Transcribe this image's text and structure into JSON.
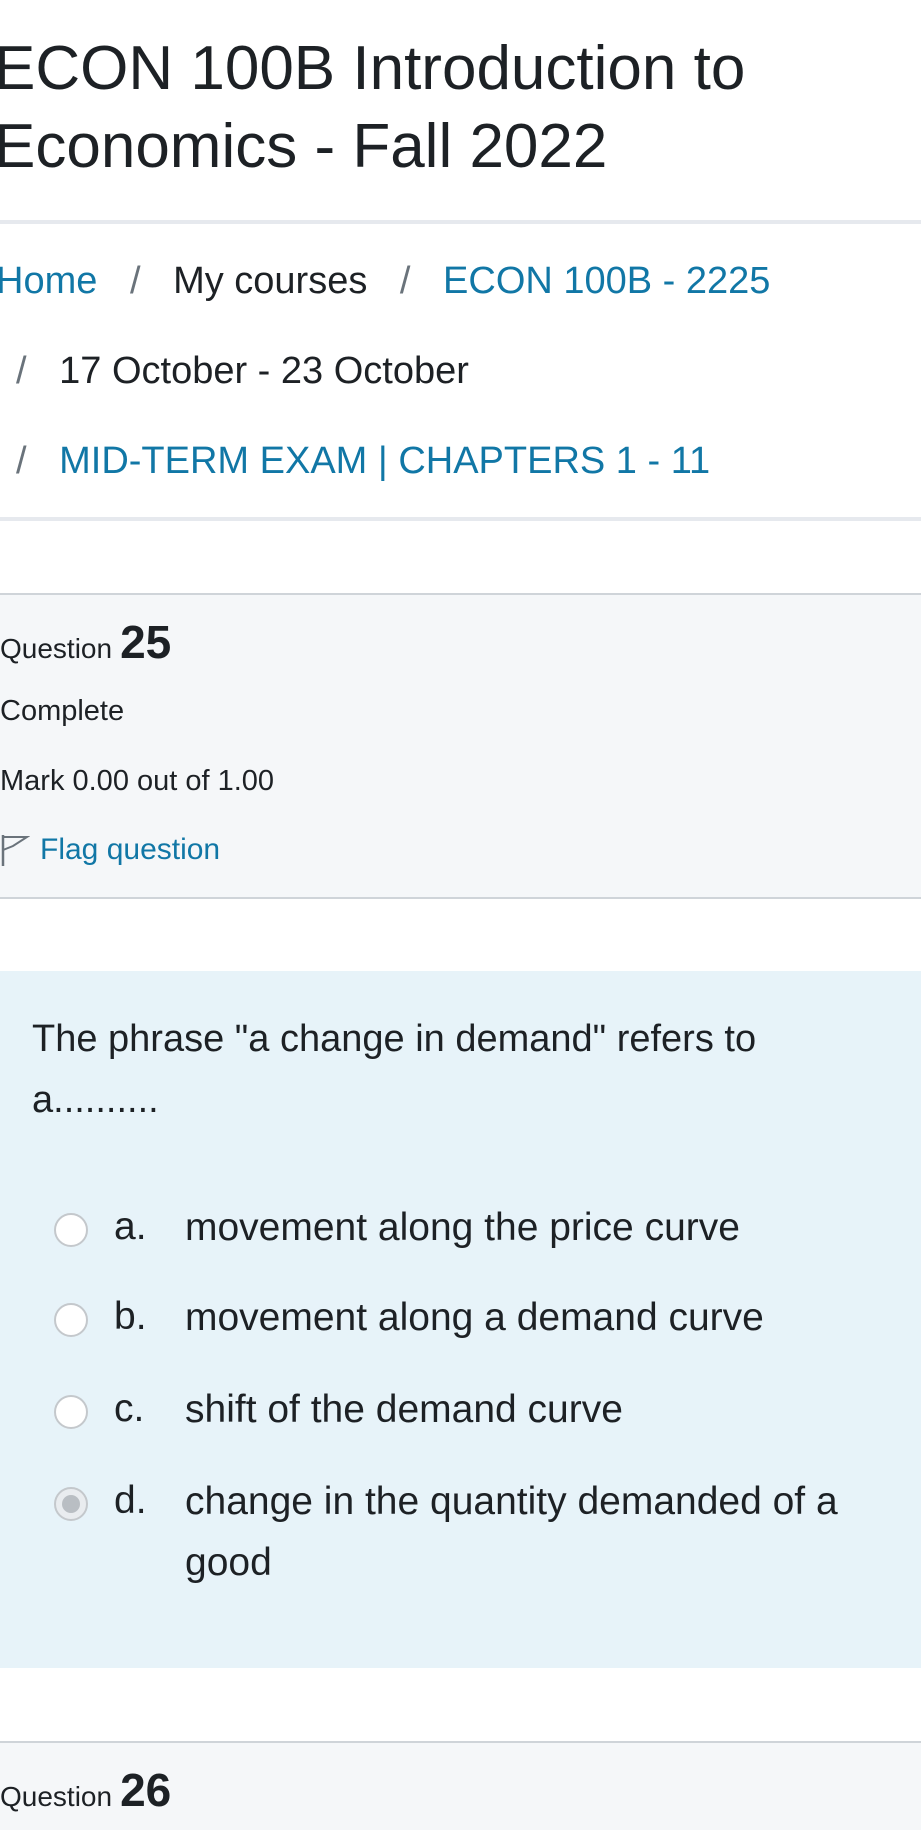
{
  "course": {
    "title": "ECON 100B Introduction to Economics - Fall 2022"
  },
  "breadcrumb": {
    "home": "Home",
    "my_courses": "My courses",
    "course_code": "ECON 100B - 2225",
    "week": "17 October - 23 October",
    "exam": "MID-TERM EXAM | CHAPTERS 1 - 11",
    "separator": "/"
  },
  "question25": {
    "label": "Question",
    "number": "25",
    "state": "Complete",
    "grade": "Mark 0.00 out of 1.00",
    "flag_label": "Flag question",
    "text": "The phrase \"a change in demand\" refers to a..........",
    "answers": [
      {
        "letter": "a.",
        "text": "movement along the price curve",
        "selected": false
      },
      {
        "letter": "b.",
        "text": "movement along a demand curve",
        "selected": false
      },
      {
        "letter": "c.",
        "text": "shift of the demand curve",
        "selected": false
      },
      {
        "letter": "d.",
        "text": "change in the quantity demanded of a good",
        "selected": true
      }
    ]
  },
  "question26": {
    "label": "Question",
    "number": "26"
  },
  "colors": {
    "link": "#1177a6",
    "info_bg": "#f5f7f9",
    "content_bg": "#e7f3f9"
  }
}
